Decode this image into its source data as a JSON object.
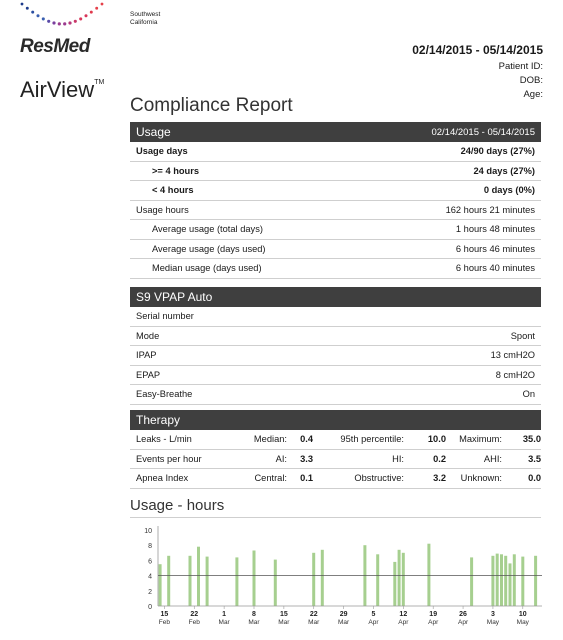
{
  "brand": {
    "company": "ResMed",
    "product": "AirView",
    "trademark": "TM"
  },
  "organization": [
    "Southwest",
    "California"
  ],
  "report": {
    "date_range": "02/14/2015 - 05/14/2015",
    "patient_id_label": "Patient ID:",
    "dob_label": "DOB:",
    "age_label": "Age:",
    "title": "Compliance Report"
  },
  "usage": {
    "header": "Usage",
    "header_dates": "02/14/2015 - 05/14/2015",
    "rows": [
      {
        "label": "Usage days",
        "value": "24/90 days (27%)"
      },
      {
        "label": ">= 4 hours",
        "value": "24 days (27%)"
      },
      {
        "label": "< 4 hours",
        "value": "0 days (0%)"
      },
      {
        "label": "Usage hours",
        "value": "162 hours 21 minutes"
      },
      {
        "label": "Average usage (total days)",
        "value": "1 hours 48 minutes"
      },
      {
        "label": "Average usage (days used)",
        "value": "6 hours 46 minutes"
      },
      {
        "label": "Median usage (days used)",
        "value": "6 hours 40 minutes"
      }
    ]
  },
  "device": {
    "header": "S9 VPAP Auto",
    "rows": [
      {
        "label": "Serial number",
        "value": ""
      },
      {
        "label": "Mode",
        "value": "Spont"
      },
      {
        "label": "IPAP",
        "value": "13 cmH2O"
      },
      {
        "label": "EPAP",
        "value": "8 cmH2O"
      },
      {
        "label": "Easy-Breathe",
        "value": "On"
      }
    ]
  },
  "therapy": {
    "header": "Therapy",
    "rows": [
      {
        "label": "Leaks - L/min",
        "c1": "Median:",
        "v1": "0.4",
        "c2": "95th percentile:",
        "v2": "10.0",
        "c3": "Maximum:",
        "v3": "35.0"
      },
      {
        "label": "Events per hour",
        "c1": "AI:",
        "v1": "3.3",
        "c2": "HI:",
        "v2": "0.2",
        "c3": "AHI:",
        "v3": "3.5"
      },
      {
        "label": "Apnea Index",
        "c1": "Central:",
        "v1": "0.1",
        "c2": "Obstructive:",
        "v2": "3.2",
        "c3": "Unknown:",
        "v3": "0.0"
      }
    ]
  },
  "colors": {
    "header_bg": "#3f3f3f",
    "bar": "#a6cf8f",
    "reference_line": "#555555"
  },
  "chart_data": {
    "type": "bar",
    "title": "Usage - hours",
    "ylim": [
      0,
      10
    ],
    "yticks": [
      0,
      2,
      4,
      6,
      8,
      10
    ],
    "reference_line": 4,
    "xticks": [
      {
        "day": "15",
        "month": "Feb"
      },
      {
        "day": "22",
        "month": "Feb"
      },
      {
        "day": "1",
        "month": "Mar"
      },
      {
        "day": "8",
        "month": "Mar"
      },
      {
        "day": "15",
        "month": "Mar"
      },
      {
        "day": "22",
        "month": "Mar"
      },
      {
        "day": "29",
        "month": "Mar"
      },
      {
        "day": "5",
        "month": "Apr"
      },
      {
        "day": "12",
        "month": "Apr"
      },
      {
        "day": "19",
        "month": "Apr"
      },
      {
        "day": "26",
        "month": "Apr"
      },
      {
        "day": "3",
        "month": "May"
      },
      {
        "day": "10",
        "month": "May"
      }
    ],
    "series": [
      {
        "values": [
          {
            "date": "02/14/2015",
            "hours": 5.5
          },
          {
            "date": "02/16/2015",
            "hours": 6.6
          },
          {
            "date": "02/21/2015",
            "hours": 6.6
          },
          {
            "date": "02/23/2015",
            "hours": 7.8
          },
          {
            "date": "02/25/2015",
            "hours": 6.5
          },
          {
            "date": "03/04/2015",
            "hours": 6.4
          },
          {
            "date": "03/08/2015",
            "hours": 7.3
          },
          {
            "date": "03/13/2015",
            "hours": 6.1
          },
          {
            "date": "03/22/2015",
            "hours": 7.0
          },
          {
            "date": "03/24/2015",
            "hours": 7.4
          },
          {
            "date": "04/03/2015",
            "hours": 8.0
          },
          {
            "date": "04/06/2015",
            "hours": 6.8
          },
          {
            "date": "04/10/2015",
            "hours": 5.8
          },
          {
            "date": "04/11/2015",
            "hours": 7.4
          },
          {
            "date": "04/12/2015",
            "hours": 7.0
          },
          {
            "date": "04/18/2015",
            "hours": 8.2
          },
          {
            "date": "04/28/2015",
            "hours": 6.4
          },
          {
            "date": "05/03/2015",
            "hours": 6.6
          },
          {
            "date": "05/04/2015",
            "hours": 6.9
          },
          {
            "date": "05/05/2015",
            "hours": 6.8
          },
          {
            "date": "05/06/2015",
            "hours": 6.6
          },
          {
            "date": "05/07/2015",
            "hours": 5.6
          },
          {
            "date": "05/08/2015",
            "hours": 6.8
          },
          {
            "date": "05/10/2015",
            "hours": 6.5
          },
          {
            "date": "05/13/2015",
            "hours": 6.6
          }
        ]
      }
    ]
  }
}
